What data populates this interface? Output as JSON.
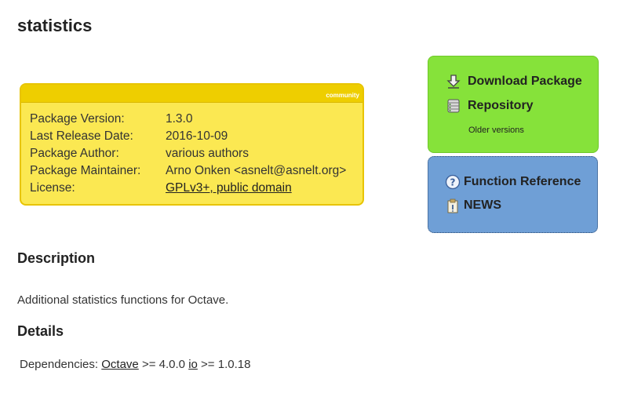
{
  "page": {
    "title": "statistics"
  },
  "info": {
    "tag": "community",
    "rows": [
      {
        "label": "Package Version:",
        "value": "1.3.0"
      },
      {
        "label": "Last Release Date:",
        "value": "2016-10-09"
      },
      {
        "label": "Package Author:",
        "value": "various authors"
      },
      {
        "label": "Package Maintainer:",
        "value": "Arno Onken <asnelt@asnelt.org>"
      },
      {
        "label": "License:",
        "value": "GPLv3+, public domain"
      }
    ]
  },
  "download_panel": {
    "download_label": "Download Package",
    "download_icon": "download-arrow-icon",
    "repository_label": "Repository",
    "repository_icon": "database-icon",
    "older_versions_label": "Older versions"
  },
  "reference_panel": {
    "function_reference_label": "Function Reference",
    "function_reference_icon": "help-icon",
    "news_label": "NEWS",
    "news_icon": "clipboard-icon"
  },
  "description": {
    "heading": "Description",
    "text": "Additional statistics functions for Octave."
  },
  "details": {
    "heading": "Details",
    "dependencies_label": "Dependencies:",
    "deps": [
      {
        "name": "Octave",
        "constraint": ">= 4.0.0"
      },
      {
        "name": "io",
        "constraint": ">= 1.0.18"
      }
    ]
  },
  "colors": {
    "info_bg": "#fbe852",
    "info_header": "#eece00",
    "download_bg": "#86e23a",
    "reference_bg": "#6f9fd6"
  }
}
